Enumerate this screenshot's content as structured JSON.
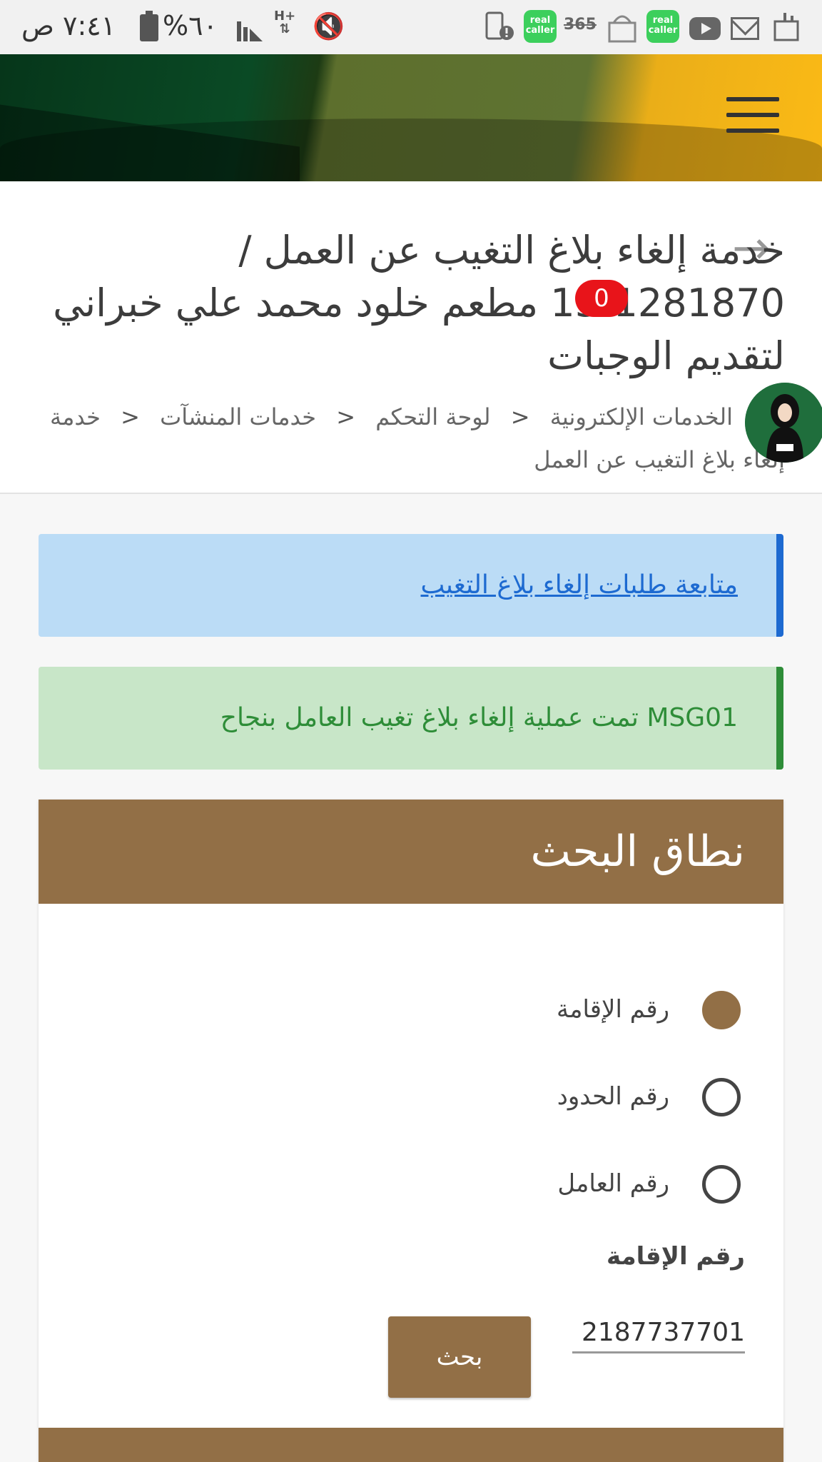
{
  "status_bar": {
    "time": "٧:٤١ ص",
    "battery": "٦٠%",
    "network": "H+",
    "app_icons": [
      "sim-alert-icon",
      "real-caller-icon",
      "app-365-icon",
      "mosque-app-icon",
      "real-caller-icon",
      "youtube-icon",
      "mail-icon",
      "android-icon"
    ],
    "real_caller_label": "real caller",
    "app_365_label": "365"
  },
  "header": {
    "title": "خدمة إلغاء بلاغ التغيب عن العمل / 1281870-13 مطعم خلود محمد علي خبراني لتقديم الوجبات",
    "badge_count": "0",
    "breadcrumb": [
      "الخدمات الإلكترونية",
      "لوحة التحكم",
      "خدمات المنشآت",
      "خدمة إلغاء بلاغ التغيب عن العمل"
    ]
  },
  "alerts": {
    "info_link": "متابعة طلبات إلغاء بلاغ التغيب",
    "success_message": "MSG01 تمت عملية إلغاء بلاغ تغيب العامل بنجاح"
  },
  "search": {
    "title": "نطاق البحث",
    "options": [
      {
        "label": "رقم الإقامة",
        "checked": true
      },
      {
        "label": "رقم الحدود",
        "checked": false
      },
      {
        "label": "رقم العامل",
        "checked": false
      }
    ],
    "field_label": "رقم الإقامة",
    "field_value": "2187737701",
    "button_label": "بحث"
  },
  "colors": {
    "brand_brown": "#926f46",
    "info_blue": "#1d6ad1",
    "success_green": "#2e8d38",
    "badge_red": "#e8141a"
  }
}
